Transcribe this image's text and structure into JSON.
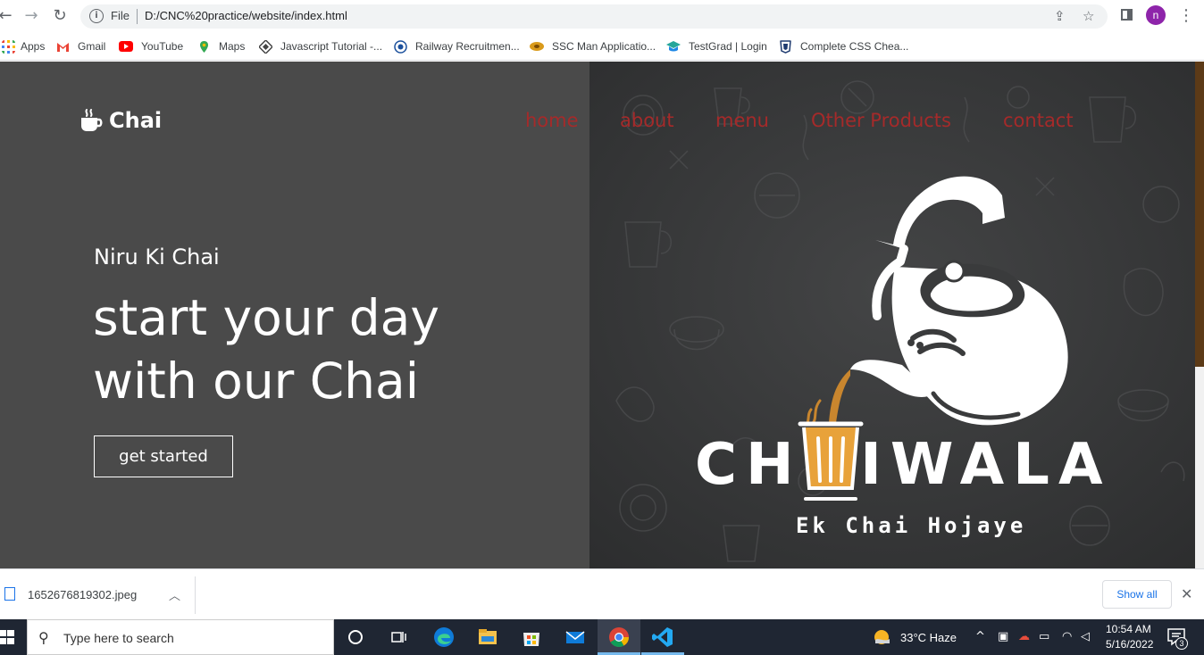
{
  "browser": {
    "omnibox": {
      "scheme_label": "File",
      "url": "D:/CNC%20practice/website/index.html"
    },
    "profile_initial": "n",
    "bookmarks": [
      {
        "label": "Apps",
        "icon": "apps-grid-icon"
      },
      {
        "label": "Gmail",
        "icon": "gmail-icon"
      },
      {
        "label": "YouTube",
        "icon": "youtube-icon"
      },
      {
        "label": "Maps",
        "icon": "maps-pin-icon"
      },
      {
        "label": "Javascript Tutorial -...",
        "icon": "javascript-tutorial-icon"
      },
      {
        "label": "Railway Recruitmen...",
        "icon": "railway-recruitment-icon"
      },
      {
        "label": "SSC Man Applicatio...",
        "icon": "ssc-icon"
      },
      {
        "label": "TestGrad | Login",
        "icon": "testgrad-icon"
      },
      {
        "label": "Complete CSS Chea...",
        "icon": "css-shield-icon"
      }
    ]
  },
  "page": {
    "logo_text": "Chai",
    "nav": [
      "home",
      "about",
      "menu",
      "Other Products",
      "contact"
    ],
    "hero": {
      "subtitle": "Niru Ki Chai",
      "title_line1": "start your day",
      "title_line2": "with our Chai",
      "cta_label": "get started"
    },
    "brand_image": {
      "word": "CH  IWALA",
      "tagline": "Ek Chai Hojaye"
    }
  },
  "downloads": {
    "file_name": "1652676819302.jpeg",
    "show_all_label": "Show all"
  },
  "taskbar": {
    "search_placeholder": "Type here to search",
    "weather": "33°C  Haze",
    "time": "10:54 AM",
    "date": "5/16/2022",
    "notification_count": "3"
  },
  "colors": {
    "hero_left_bg": "#4a4a4a",
    "nav_link": "#a52a2a",
    "scroll_thumb": "#5c3a17",
    "taskbar_bg": "#1f2633",
    "cup_orange": "#e8a23a"
  }
}
